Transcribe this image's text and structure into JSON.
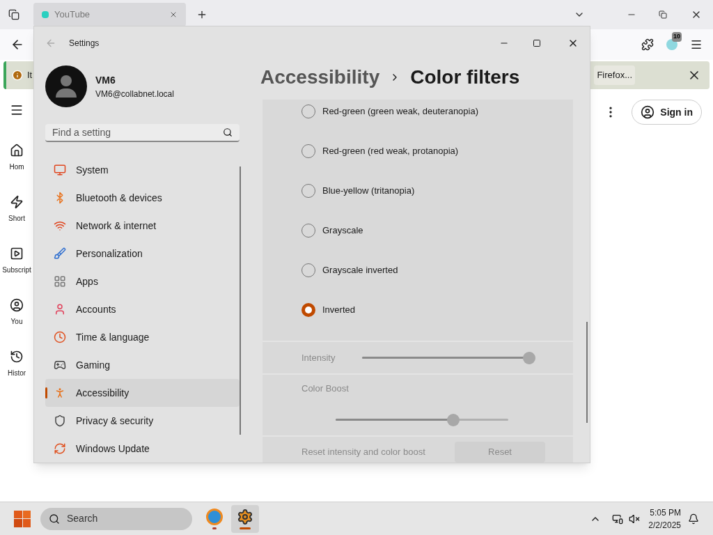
{
  "browser": {
    "tabs": [
      {
        "title": "YouTube",
        "selected": true
      }
    ],
    "extension_badge": "10",
    "notification": {
      "text": "It",
      "button": "Firefox..."
    },
    "youtube": {
      "nav": [
        {
          "label": "Hom"
        },
        {
          "label": "Short"
        },
        {
          "label": "Subscript"
        },
        {
          "label": "You"
        },
        {
          "label": "Histor"
        }
      ],
      "sign_in": "Sign in"
    }
  },
  "settings_window": {
    "title": "Settings",
    "user": {
      "name": "VM6",
      "email": "VM6@collabnet.local"
    },
    "search": {
      "placeholder": "Find a setting"
    },
    "nav": [
      {
        "label": "System",
        "selected": false
      },
      {
        "label": "Bluetooth & devices",
        "selected": false
      },
      {
        "label": "Network & internet",
        "selected": false
      },
      {
        "label": "Personalization",
        "selected": false
      },
      {
        "label": "Apps",
        "selected": false
      },
      {
        "label": "Accounts",
        "selected": false
      },
      {
        "label": "Time & language",
        "selected": false
      },
      {
        "label": "Gaming",
        "selected": false
      },
      {
        "label": "Accessibility",
        "selected": true
      },
      {
        "label": "Privacy & security",
        "selected": false
      },
      {
        "label": "Windows Update",
        "selected": false
      }
    ],
    "breadcrumb": {
      "parent": "Accessibility",
      "current": "Color filters"
    },
    "filters": [
      {
        "label": "Red-green (green weak, deuteranopia)",
        "selected": false
      },
      {
        "label": "Red-green (red weak, protanopia)",
        "selected": false
      },
      {
        "label": "Blue-yellow (tritanopia)",
        "selected": false
      },
      {
        "label": "Grayscale",
        "selected": false
      },
      {
        "label": "Grayscale inverted",
        "selected": false
      },
      {
        "label": "Inverted",
        "selected": true
      }
    ],
    "intensity": {
      "label": "Intensity",
      "level": 1
    },
    "color_boost": {
      "label": "Color Boost",
      "level": 0.68
    },
    "reset": {
      "text": "Reset intensity and color boost",
      "button": "Reset"
    }
  },
  "taskbar": {
    "search_placeholder": "Search",
    "apps": [
      {
        "selected": false
      },
      {
        "selected": true
      }
    ],
    "time": "5:05 PM",
    "date": "2/2/2025"
  }
}
